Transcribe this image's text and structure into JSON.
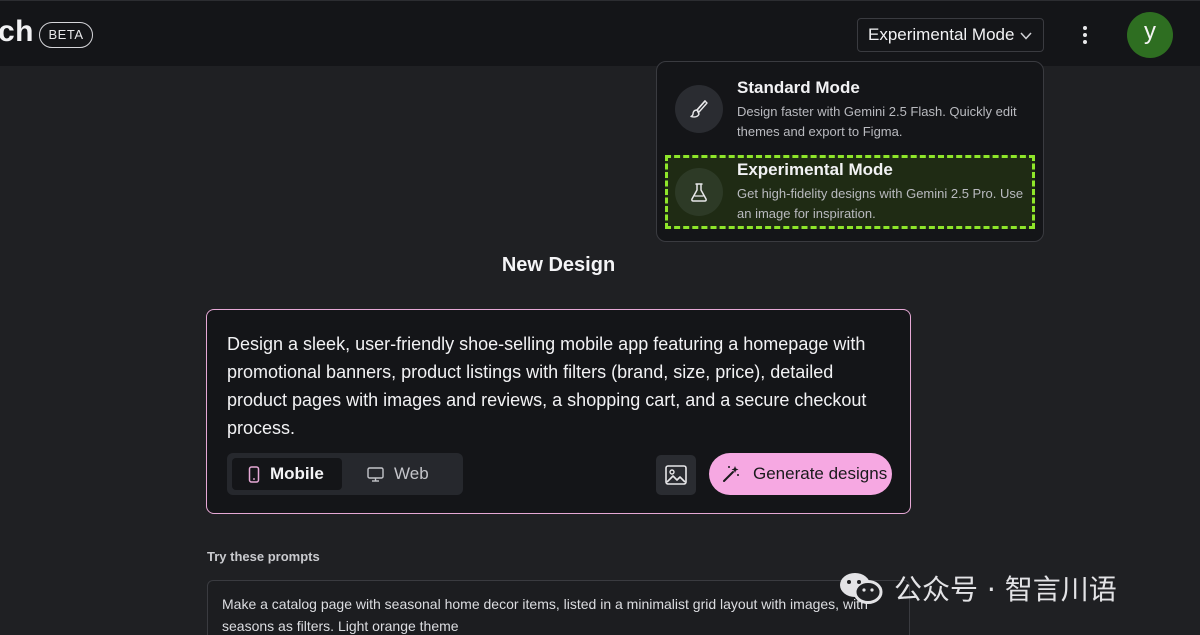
{
  "header": {
    "brand": "ch",
    "beta_badge": "BETA",
    "mode_selector": "Experimental Mode",
    "avatar_initial": "y",
    "avatar_color": "#2e6e21"
  },
  "mode_menu": {
    "items": [
      {
        "title": "Standard Mode",
        "description": "Design faster with Gemini 2.5 Flash. Quickly edit themes and export to Figma.",
        "icon": "brush-icon"
      },
      {
        "title": "Experimental Mode",
        "description": "Get high-fidelity designs with Gemini 2.5 Pro. Use an image for inspiration.",
        "icon": "flask-icon",
        "highlight_color": "#8ee52a"
      }
    ]
  },
  "main": {
    "heading": "New Design",
    "prompt": "Design a sleek, user-friendly shoe-selling mobile app featuring a homepage with promotional banners, product listings with filters (brand, size, price), detailed product pages with images and reviews, a shopping cart, and a secure checkout process.",
    "platform": {
      "mobile_label": "Mobile",
      "web_label": "Web",
      "selected": "Mobile"
    },
    "image_button_icon": "image-icon",
    "generate_label": "Generate designs",
    "accent_color": "#f6a8e2"
  },
  "suggestions": {
    "label": "Try these prompts",
    "items": [
      "Make a catalog page with seasonal home decor items, listed in a minimalist grid layout with images, with seasons as filters. Light orange theme"
    ]
  },
  "watermark": {
    "text": "公众号 · 智言川语"
  }
}
